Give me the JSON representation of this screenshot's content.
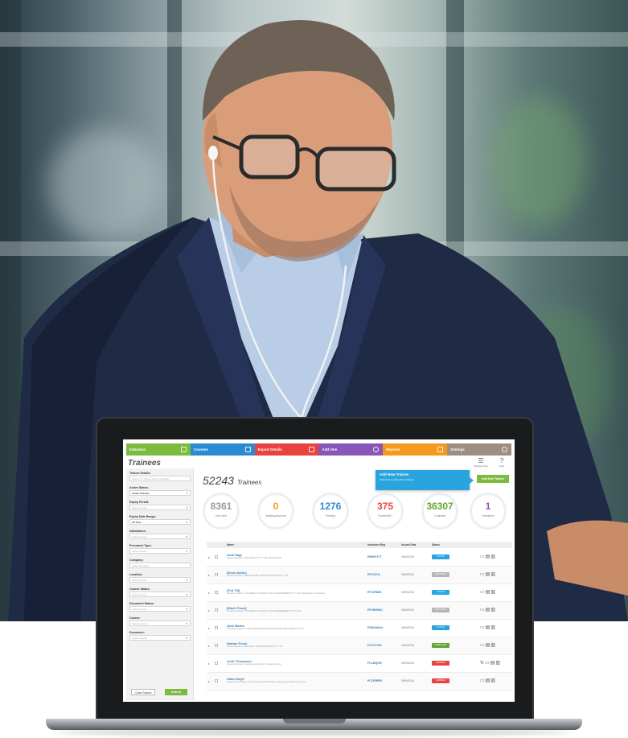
{
  "laptop_app": {
    "nav": [
      {
        "label": "Induction",
        "color": "#7dbb3f"
      },
      {
        "label": "Courses",
        "color": "#2a8bd3"
      },
      {
        "label": "Export Details",
        "color": "#e8433e"
      },
      {
        "label": "Add One",
        "color": "#8a55b8"
      },
      {
        "label": "Reports",
        "color": "#f39a1e"
      },
      {
        "label": "Settings",
        "color": "#9c8e82"
      }
    ],
    "page_title": "Trainees",
    "header_icons": [
      {
        "icon": "list-view-icon",
        "label": "Change View"
      },
      {
        "icon": "help-icon",
        "label": "Help"
      }
    ],
    "filters": [
      {
        "label": "Trainee Details:",
        "value": "Search by Trainee Name & Details",
        "selected": false
      },
      {
        "label": "Active Status:",
        "value": "Active Trainees",
        "selected": true
      },
      {
        "label": "Expiry Period:",
        "value": "Select options",
        "selected": false
      },
      {
        "label": "Expiry Date Range:",
        "value": "All Time",
        "selected": true
      },
      {
        "label": "Attendance:",
        "value": "Select options",
        "selected": false
      },
      {
        "label": "Personnel Type:",
        "value": "Select options",
        "selected": false
      },
      {
        "label": "Company:",
        "value": "Select Company",
        "selected": false
      },
      {
        "label": "Location:",
        "value": "Select options",
        "selected": false
      },
      {
        "label": "Course Status:",
        "value": "Select options",
        "selected": false
      },
      {
        "label": "Document Status:",
        "value": "Select options",
        "selected": false
      },
      {
        "label": "Course:",
        "value": "Select options",
        "selected": false
      },
      {
        "label": "Document:",
        "value": "Select options",
        "selected": false
      }
    ],
    "close_search_label": "Close Search",
    "search_label": "Search",
    "trainee_count": "52243",
    "trainee_count_label": "Trainees",
    "tooltip": {
      "title": "Add New Trainee",
      "text": "Click here to add a New Trainee"
    },
    "add_trainee_label": "Add New Trainee",
    "stats": [
      {
        "value": "8361",
        "label": "Not Used",
        "color": "#9a9a9a"
      },
      {
        "value": "0",
        "label": "Awaiting Approval",
        "color": "#f39a1e"
      },
      {
        "value": "1276",
        "label": "Pending",
        "color": "#2a8bd3"
      },
      {
        "value": "375",
        "label": "Expired/N/C",
        "color": "#e8433e"
      },
      {
        "value": "36307",
        "label": "Compliant",
        "color": "#5ea82f"
      },
      {
        "value": "1",
        "label": "Exemption",
        "color": "#8a55b8"
      }
    ],
    "table_headers": {
      "name": "Name",
      "ref": "Induction Reg",
      "date": "Issued Date",
      "status": "Status"
    },
    "rows": [
      {
        "name": "Andi Nagi",
        "detail": "Issued Induction  |  MN GROUP PTY LTD  |  MN GROUP",
        "ref": "PENHY1TT",
        "date": "05/06/2016",
        "status": "ACTIVE",
        "status_color": "#2aa4de"
      },
      {
        "name": "[Dean Addis]",
        "detail": "Issued Induction  |  MIDDLETON CONSTRUCTIONS PTY LTD",
        "ref": "PE7V571L",
        "date": "05/06/2016",
        "status": "ARCHIVED",
        "status_color": "#b5b5b5"
      },
      {
        "name": "[Ted Till]",
        "detail": "Pending Induction  |  MARINE & COASTAL CIVIL ENGINEERING PTY LTD  |  Maintenance Induction",
        "ref": "PF1VF8MS",
        "date": "05/06/2016",
        "status": "ACTIVE",
        "status_color": "#2aa4de"
      },
      {
        "name": "[Mack Franz]",
        "detail": "Pending Induction  |  MARINE & COASTAL CIVIL ENGINEERING PTY LTD",
        "ref": "PEYMHS6U",
        "date": "05/06/2016",
        "status": "ARCHIVED",
        "status_color": "#b5b5b5"
      },
      {
        "name": "Jack Martin",
        "detail": "Pending Induction  |  THE PROFESSIONALS BUILDING SERVICES PTY LTD",
        "ref": "PDNUHAH4",
        "date": "05/06/2016",
        "status": "ACTIVE",
        "status_color": "#2aa4de"
      },
      {
        "name": "Nathan Fresh",
        "detail": "Issued Induction  |  BUILDCO CONTRACTORS PTY LTD",
        "ref": "PCZYT7SD",
        "date": "05/06/2016",
        "status": "COMPLIANT",
        "status_color": "#5ea82f"
      },
      {
        "name": "Josh Thompson",
        "detail": "Issued Induction  |  Landscape Induction  |  Roads Group",
        "ref": "PCLMQH9I",
        "date": "05/06/2016",
        "status": "EXPIRED",
        "status_color": "#e8433e"
      },
      {
        "name": "Allan Doyle",
        "detail": "Issued Head Office  |  Intune Powered Scheduling  |  Blue Quest Parking Services",
        "ref": "PCZF5RPR",
        "date": "05/06/2016",
        "status": "EXPIRED",
        "status_color": "#e8433e"
      }
    ]
  }
}
